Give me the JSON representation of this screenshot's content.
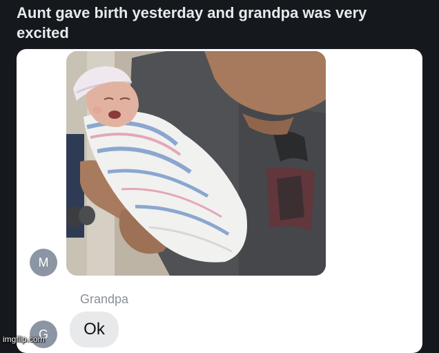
{
  "post": {
    "title": "Aunt gave birth yesterday and grandpa was very excited"
  },
  "chat": {
    "avatars": {
      "first": "M",
      "second": "G"
    },
    "photo": {
      "alt": "newborn-baby-photo"
    },
    "sender_name": "Grandpa",
    "message": "Ok"
  },
  "watermark": "imgflip.com",
  "colors": {
    "page_background": "#15181d",
    "title_text": "#e8eaed",
    "card_background": "#ffffff",
    "avatar_background": "#8b95a3",
    "bubble_background": "#e8e9eb"
  }
}
